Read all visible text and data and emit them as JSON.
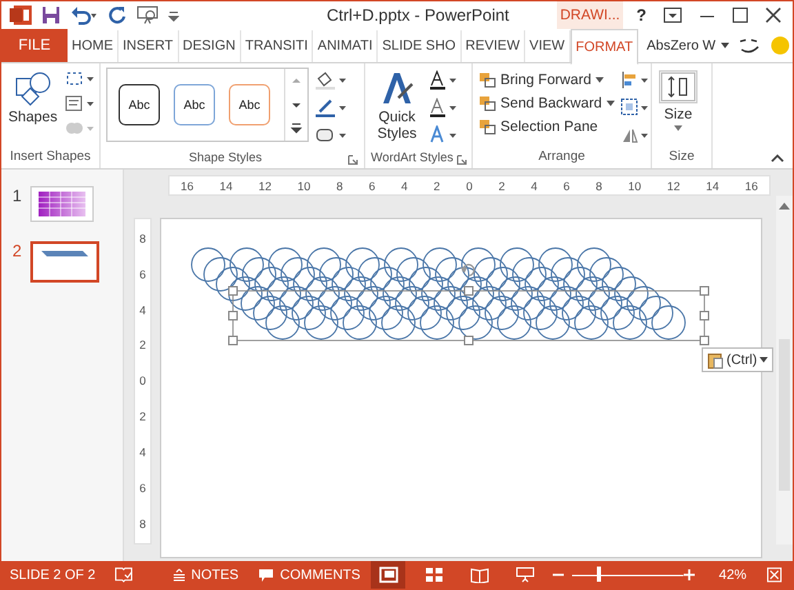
{
  "window": {
    "title": "Ctrl+D.pptx - PowerPoint",
    "context_tab": "DRAWI...",
    "help": "?"
  },
  "tabs": [
    {
      "label": "FILE",
      "kind": "file",
      "selected": false
    },
    {
      "label": "HOME",
      "kind": "tab",
      "selected": false
    },
    {
      "label": "INSERT",
      "kind": "tab",
      "selected": false
    },
    {
      "label": "DESIGN",
      "kind": "tab",
      "selected": false
    },
    {
      "label": "TRANSITI",
      "kind": "tab",
      "selected": false
    },
    {
      "label": "ANIMATI",
      "kind": "tab",
      "selected": false
    },
    {
      "label": "SLIDE SHO",
      "kind": "tab",
      "selected": false
    },
    {
      "label": "REVIEW",
      "kind": "tab",
      "selected": false
    },
    {
      "label": "VIEW",
      "kind": "tab",
      "selected": false
    },
    {
      "label": "FORMAT",
      "kind": "tab",
      "selected": true
    }
  ],
  "account": "AbsZero W",
  "ribbon": {
    "insert_shapes": {
      "label": "Insert Shapes",
      "shapes_button": "Shapes"
    },
    "shape_styles": {
      "label": "Shape Styles",
      "styles": [
        {
          "text": "Abc",
          "color": "#333333"
        },
        {
          "text": "Abc",
          "color": "#7ea6d8"
        },
        {
          "text": "Abc",
          "color": "#f0a070"
        }
      ]
    },
    "wordart_styles": {
      "label": "WordArt Styles",
      "quick_styles": "Quick Styles"
    },
    "arrange": {
      "label": "Arrange",
      "items": [
        "Bring Forward",
        "Send Backward",
        "Selection Pane"
      ]
    },
    "size": {
      "label": "Size",
      "button": "Size"
    }
  },
  "slides": [
    {
      "number": "1",
      "kind": "gradient",
      "selected": false
    },
    {
      "number": "2",
      "kind": "band",
      "selected": true
    }
  ],
  "ruler": {
    "horizontal": [
      "16",
      "14",
      "12",
      "10",
      "8",
      "6",
      "4",
      "2",
      "0",
      "2",
      "4",
      "6",
      "8",
      "10",
      "12",
      "14",
      "16"
    ],
    "vertical": [
      "8",
      "6",
      "4",
      "2",
      "0",
      "2",
      "4",
      "6",
      "8"
    ]
  },
  "paste_options": "(Ctrl)",
  "status_bar": {
    "slide": "SLIDE 2 OF 2",
    "notes": "NOTES",
    "comments": "COMMENTS",
    "views": [
      {
        "kind": "normal",
        "selected": true
      },
      {
        "kind": "sorter",
        "selected": false
      },
      {
        "kind": "reading",
        "selected": false
      },
      {
        "kind": "show",
        "selected": false
      }
    ],
    "zoom": {
      "level": 0.22,
      "reading": "42%"
    }
  }
}
